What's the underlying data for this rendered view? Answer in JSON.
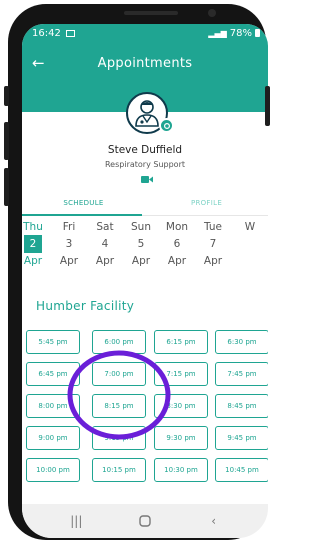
{
  "status_bar": {
    "time": "16:42",
    "battery": "78%"
  },
  "header": {
    "title": "Appointments",
    "back_icon": "arrow-left-icon"
  },
  "profile": {
    "name": "Steve Duffield",
    "role": "Respiratory Support",
    "avatar_icon": "doctor-avatar-icon",
    "call_icon": "video-camera-icon"
  },
  "tabs": [
    {
      "label": "SCHEDULE",
      "active": true
    },
    {
      "label": "PROFILE",
      "active": false
    }
  ],
  "days": [
    {
      "day": "Thu",
      "date": "2",
      "month": "Apr",
      "selected": true
    },
    {
      "day": "Fri",
      "date": "3",
      "month": "Apr"
    },
    {
      "day": "Sat",
      "date": "4",
      "month": "Apr"
    },
    {
      "day": "Sun",
      "date": "5",
      "month": "Apr"
    },
    {
      "day": "Mon",
      "date": "6",
      "month": "Apr"
    },
    {
      "day": "Tue",
      "date": "7",
      "month": "Apr"
    },
    {
      "day": "W",
      "date": "",
      "month": ""
    }
  ],
  "facility": "Humber Facility",
  "slots": [
    [
      "5:45 pm",
      "6:00 pm",
      "6:15 pm",
      "6:30 pm"
    ],
    [
      "6:45 pm",
      "7:00 pm",
      "7:15 pm",
      "7:45 pm"
    ],
    [
      "8:00 pm",
      "8:15 pm",
      "8:30 pm",
      "8:45 pm"
    ],
    [
      "9:00 pm",
      "9:15 pm",
      "9:30 pm",
      "9:45 pm"
    ],
    [
      "10:00 pm",
      "10:15 pm",
      "10:30 pm",
      "10:45 pm"
    ]
  ],
  "colors": {
    "accent": "#1fa592",
    "annotation": "#6a1fd8"
  }
}
